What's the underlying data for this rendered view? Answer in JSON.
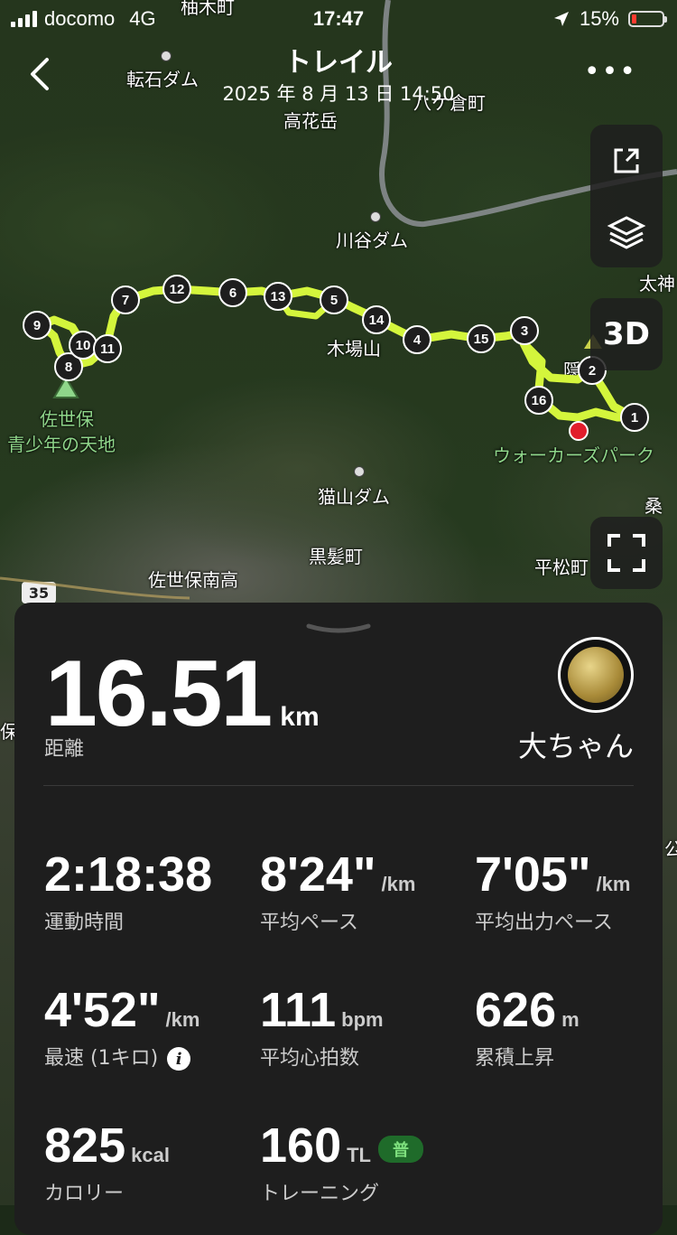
{
  "status_bar": {
    "carrier": "docomo",
    "network": "4G",
    "time": "17:47",
    "battery": "15%"
  },
  "header": {
    "title": "トレイル",
    "subtitle": "2025 年 8 月 13 日 14:50"
  },
  "map": {
    "place_labels": {
      "yuki": "柚木町",
      "tenseki_dam": "転石ダム",
      "hachikura": "八ケ倉町",
      "takahana": "高花岳",
      "kawatani_dam": "川谷ダム",
      "daijin": "太神",
      "kibayama": "木場山",
      "kakuredake": "隠岳",
      "sasebo_seishonen_1": "佐世保",
      "sasebo_seishonen_2": "青少年の天地",
      "walkers_park": "ウォーカーズパーク",
      "nekoyama_dam": "猫山ダム",
      "kurokami": "黒髪町",
      "sasebo_minami": "佐世保南高",
      "hiramatsu": "平松町",
      "kuwa": "桑",
      "ko": "公",
      "ho": "保",
      "route_35": "35"
    },
    "markers": [
      "1",
      "2",
      "3",
      "4",
      "5",
      "6",
      "7",
      "8",
      "9",
      "10",
      "11",
      "12",
      "13",
      "14",
      "15",
      "16"
    ],
    "route_color": "#d4f53c",
    "btn_3d": "3D"
  },
  "summary": {
    "distance_value": "16.51",
    "distance_unit": "km",
    "distance_label": "距離",
    "user_name": "大ちゃん",
    "stats": [
      {
        "value": "2:18:38",
        "unit": "",
        "label": "運動時間"
      },
      {
        "value": "8'24\"",
        "unit": "/km",
        "label": "平均ペース"
      },
      {
        "value": "7'05\"",
        "unit": "/km",
        "label": "平均出力ペース"
      },
      {
        "value": "4'52\"",
        "unit": "/km",
        "label": "最速 (1キロ)"
      },
      {
        "value": "111",
        "unit": "bpm",
        "label": "平均心拍数"
      },
      {
        "value": "626",
        "unit": "m",
        "label": "累積上昇"
      },
      {
        "value": "825",
        "unit": "kcal",
        "label": "カロリー"
      },
      {
        "value": "160",
        "unit": "TL",
        "label": "トレーニング"
      }
    ],
    "tl_badge": "普"
  }
}
